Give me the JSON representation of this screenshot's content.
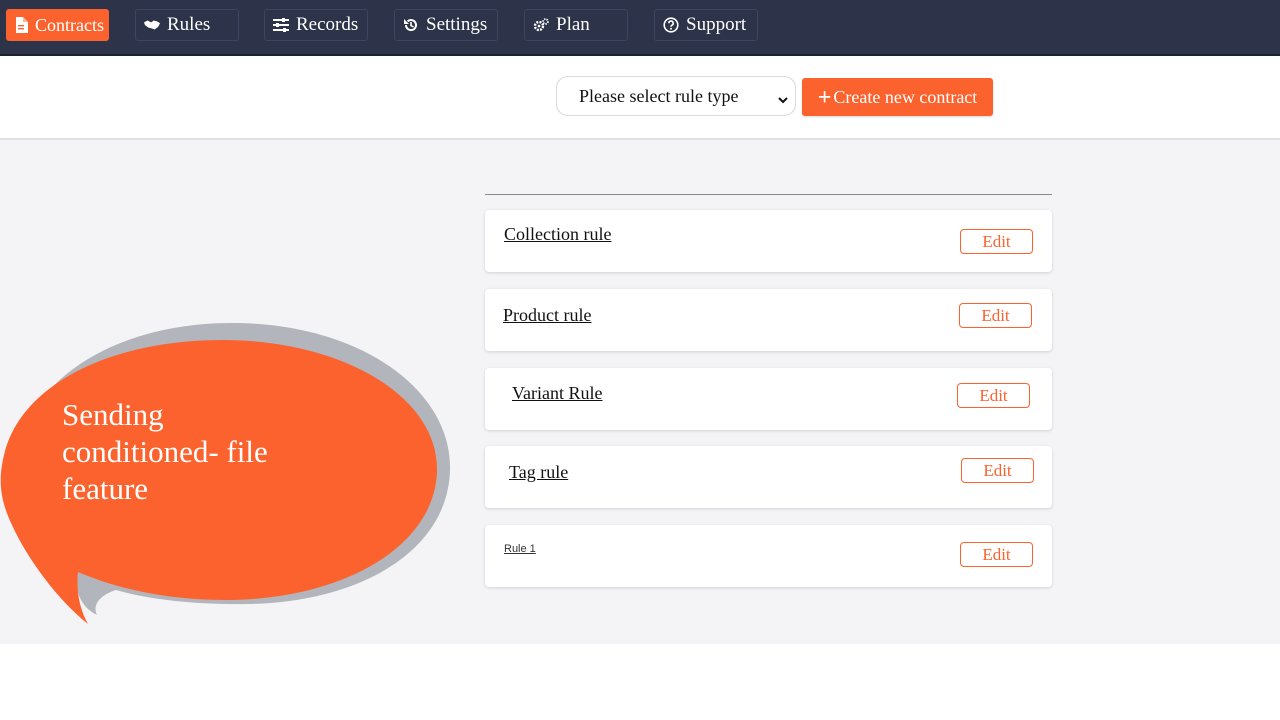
{
  "nav": {
    "items": [
      {
        "label": "Contracts",
        "icon": "file-icon",
        "active": true
      },
      {
        "label": "Rules",
        "icon": "handshake-icon",
        "active": false
      },
      {
        "label": "Records",
        "icon": "sliders-icon",
        "active": false
      },
      {
        "label": "Settings",
        "icon": "history-icon",
        "active": false
      },
      {
        "label": "Plan",
        "icon": "gears-icon",
        "active": false
      },
      {
        "label": "Support",
        "icon": "question-circle-icon",
        "active": false
      }
    ]
  },
  "toolbar": {
    "rule_type_select": {
      "selected": "Please select rule type",
      "icon": "chevron-down-icon"
    },
    "create_button": {
      "label": "Create new contract",
      "icon": "plus-icon"
    }
  },
  "rules": [
    {
      "name": "Collection rule",
      "edit_label": "Edit"
    },
    {
      "name": "Product rule",
      "edit_label": "Edit"
    },
    {
      "name": "Variant Rule",
      "edit_label": "Edit"
    },
    {
      "name": "Tag rule",
      "edit_label": "Edit"
    },
    {
      "name": "Rule 1",
      "edit_label": "Edit"
    }
  ],
  "callout": {
    "lines": [
      "Sending",
      "conditioned- file",
      "feature"
    ]
  },
  "colors": {
    "accent": "#fc622d",
    "nav_bg": "#2d3349",
    "content_bg": "#f4f4f6",
    "bubble_shadow": "#b3b5bc"
  }
}
